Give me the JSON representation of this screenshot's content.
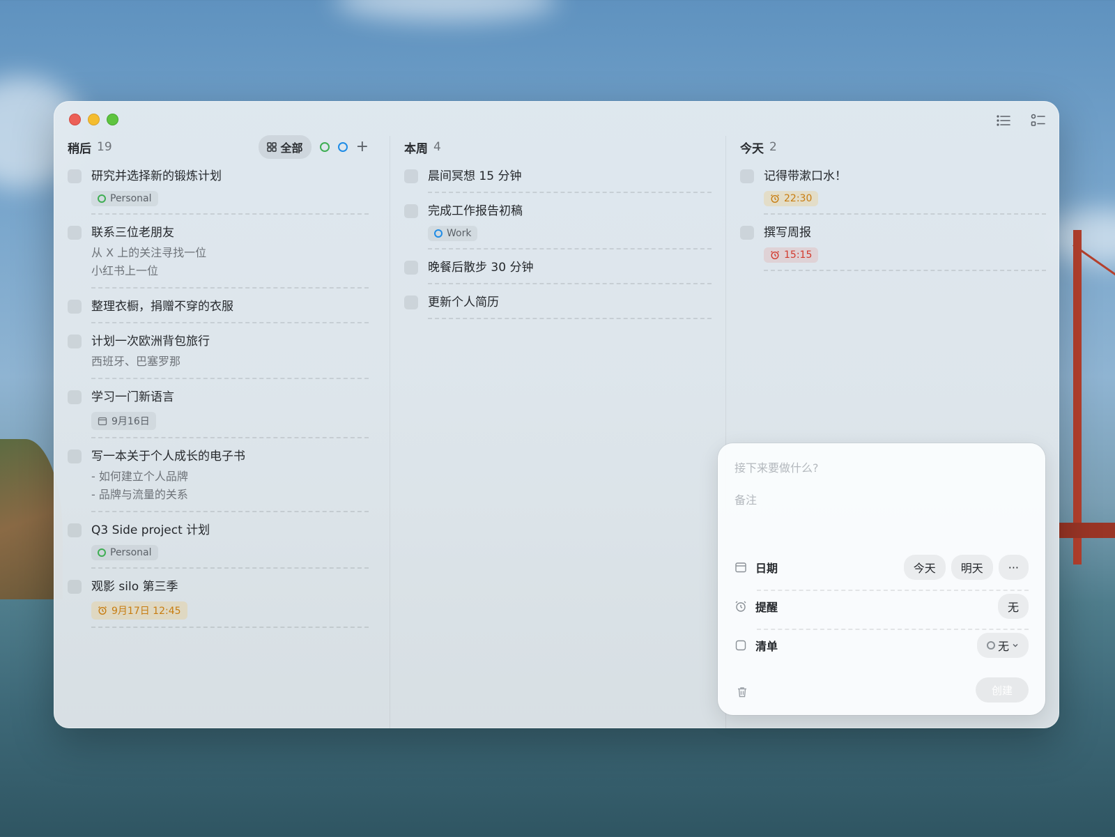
{
  "later": {
    "title": "稍后",
    "count": "19",
    "filter_all": "全部",
    "filter_green_color": "#3fae54",
    "filter_blue_color": "#1f8ce6",
    "tasks": [
      {
        "title": "研究并选择新的锻炼计划",
        "tag": "Personal"
      },
      {
        "title": "联系三位老朋友",
        "note1": "从 X 上的关注寻找一位",
        "note2": "小红书上一位"
      },
      {
        "title": "整理衣橱，捐赠不穿的衣服"
      },
      {
        "title": "计划一次欧洲背包旅行",
        "note1": "西班牙、巴塞罗那"
      },
      {
        "title": "学习一门新语言",
        "date": "9月16日"
      },
      {
        "title": "写一本关于个人成长的电子书",
        "note1": "- 如何建立个人品牌",
        "note2": "- 品牌与流量的关系"
      },
      {
        "title": "Q3 Side project 计划",
        "tag": "Personal"
      },
      {
        "title": "观影 silo 第三季",
        "alarm": "9月17日 12:45"
      }
    ]
  },
  "week": {
    "title": "本周",
    "count": "4",
    "tasks": [
      {
        "title": "晨间冥想 15 分钟"
      },
      {
        "title": "完成工作报告初稿",
        "tag": "Work"
      },
      {
        "title": "晚餐后散步 30 分钟"
      },
      {
        "title": "更新个人简历"
      }
    ]
  },
  "today": {
    "title": "今天",
    "count": "2",
    "tasks": [
      {
        "title": "记得带漱口水！",
        "alarm": "22:30"
      },
      {
        "title": "撰写周报",
        "alarm": "15:15"
      }
    ]
  },
  "composer": {
    "title_placeholder": "接下来要做什么?",
    "notes_placeholder": "备注",
    "date_label": "日期",
    "date_today": "今天",
    "date_tomorrow": "明天",
    "date_more": "···",
    "reminder_label": "提醒",
    "reminder_value": "无",
    "list_label": "清单",
    "list_value": "无",
    "create_label": "创建"
  }
}
